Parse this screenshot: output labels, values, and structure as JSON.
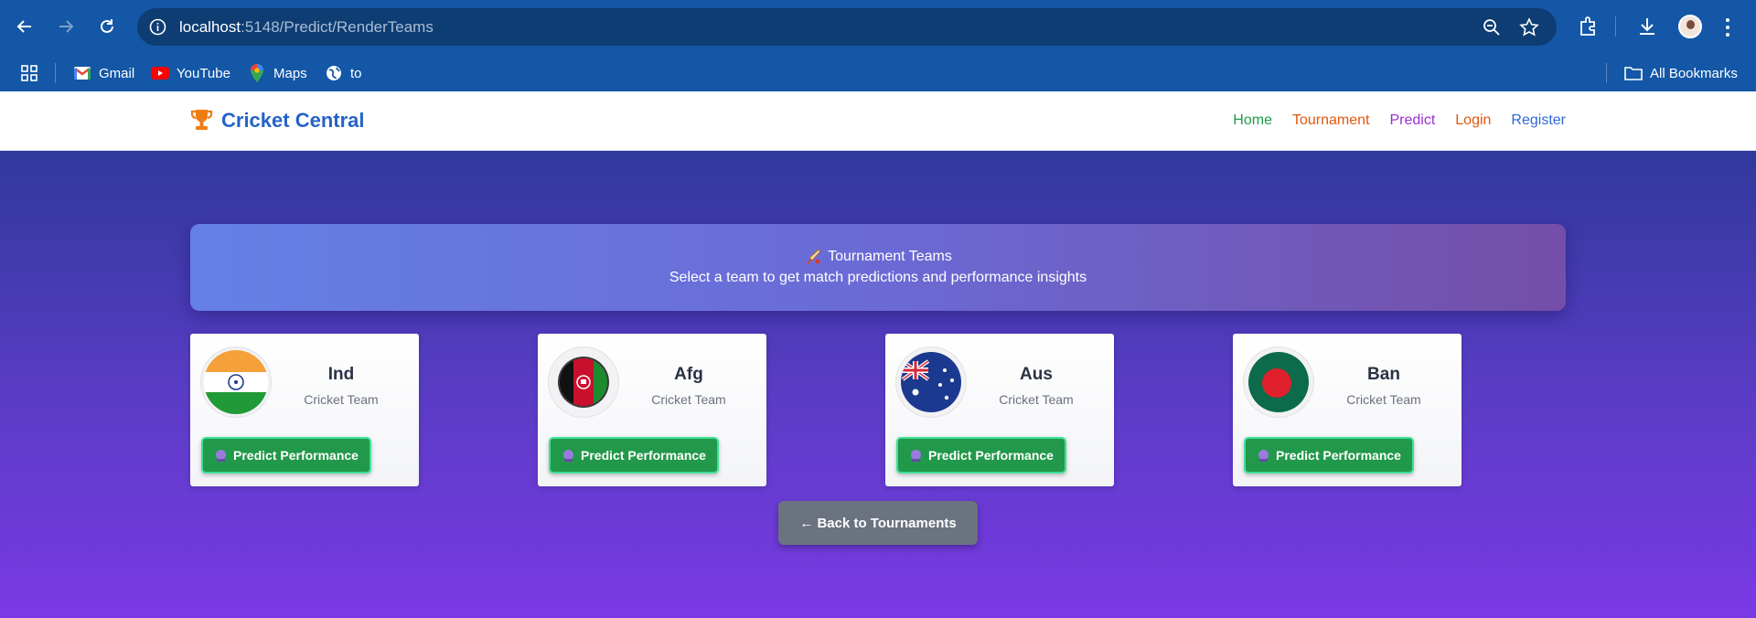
{
  "browser": {
    "url_host": "localhost",
    "url_path": ":5148/Predict/RenderTeams",
    "bookmarks": [
      {
        "label": "Gmail",
        "icon": "gmail-icon"
      },
      {
        "label": "YouTube",
        "icon": "youtube-icon"
      },
      {
        "label": "Maps",
        "icon": "maps-icon"
      },
      {
        "label": "to",
        "icon": "globe-icon"
      }
    ],
    "all_bookmarks_label": "All Bookmarks"
  },
  "site": {
    "brand": "Cricket Central",
    "nav": [
      {
        "label": "Home",
        "color": "#16a34a"
      },
      {
        "label": "Tournament",
        "color": "#ea580c"
      },
      {
        "label": "Predict",
        "color": "#9333ea"
      },
      {
        "label": "Login",
        "color": "#ea580c"
      },
      {
        "label": "Register",
        "color": "#2563eb"
      }
    ]
  },
  "banner": {
    "title": "Tournament Teams",
    "subtitle": "Select a team to get match predictions and performance insights"
  },
  "teams": [
    {
      "name": "Ind",
      "subtitle": "Cricket Team",
      "button": "Predict Performance",
      "flag": "india-flag-icon"
    },
    {
      "name": "Afg",
      "subtitle": "Cricket Team",
      "button": "Predict Performance",
      "flag": "afghanistan-flag-icon"
    },
    {
      "name": "Aus",
      "subtitle": "Cricket Team",
      "button": "Predict Performance",
      "flag": "australia-flag-icon"
    },
    {
      "name": "Ban",
      "subtitle": "Cricket Team",
      "button": "Predict Performance",
      "flag": "bangladesh-flag-icon"
    }
  ],
  "back_button": "← Back to Tournaments",
  "colors": {
    "chrome": "#1357a6",
    "brand": "#2563c9",
    "button_green": "#21984a",
    "back_gray": "#6b7280"
  }
}
